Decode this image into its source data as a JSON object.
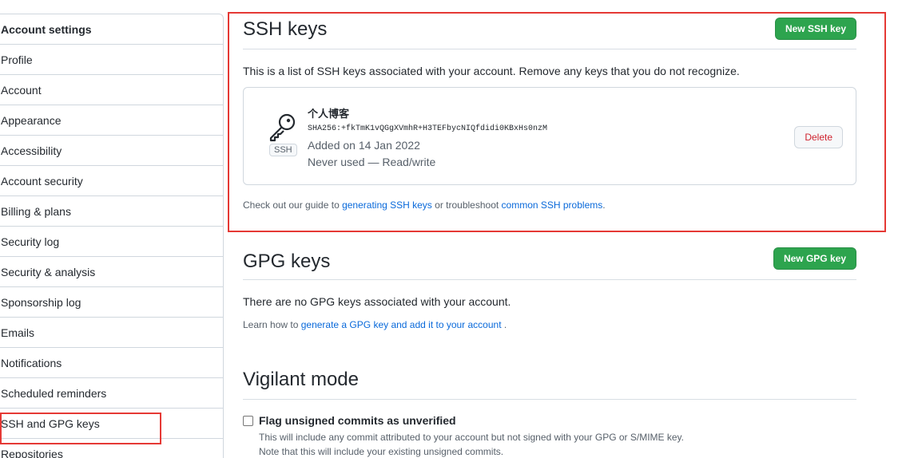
{
  "sidebar": {
    "header": "Account settings",
    "items": [
      {
        "label": "Profile"
      },
      {
        "label": "Account"
      },
      {
        "label": "Appearance"
      },
      {
        "label": "Accessibility"
      },
      {
        "label": "Account security"
      },
      {
        "label": "Billing & plans"
      },
      {
        "label": "Security log"
      },
      {
        "label": "Security & analysis"
      },
      {
        "label": "Sponsorship log"
      },
      {
        "label": "Emails"
      },
      {
        "label": "Notifications"
      },
      {
        "label": "Scheduled reminders"
      },
      {
        "label": "SSH and GPG keys"
      },
      {
        "label": "Repositories"
      }
    ]
  },
  "ssh": {
    "title": "SSH keys",
    "new_button": "New SSH key",
    "description": "This is a list of SSH keys associated with your account. Remove any keys that you do not recognize.",
    "key": {
      "name": "个人博客",
      "fingerprint": "SHA256:+fkTmK1vQGgXVmhR+H3TEFbycNIQfdidi0KBxHs0nzM",
      "added": "Added on 14 Jan 2022",
      "usage": "Never used — Read/write",
      "badge": "SSH",
      "delete_button": "Delete"
    },
    "guide_prefix": "Check out our guide to ",
    "guide_link1": "generating SSH keys",
    "guide_middle": " or troubleshoot ",
    "guide_link2": "common SSH problems",
    "guide_suffix": "."
  },
  "gpg": {
    "title": "GPG keys",
    "new_button": "New GPG key",
    "empty_text": "There are no GPG keys associated with your account.",
    "learn_prefix": "Learn how to ",
    "learn_link": "generate a GPG key and add it to your account",
    "learn_suffix": " ."
  },
  "vigilant": {
    "title": "Vigilant mode",
    "checkbox_label": "Flag unsigned commits as unverified",
    "checked": false,
    "note1": "This will include any commit attributed to your account but not signed with your GPG or S/MIME key.",
    "note2": "Note that this will include your existing unsigned commits."
  },
  "colors": {
    "accent_green": "#2da44e",
    "link_blue": "#0969da",
    "danger_red": "#cf222e",
    "highlight_red": "#e53935"
  }
}
